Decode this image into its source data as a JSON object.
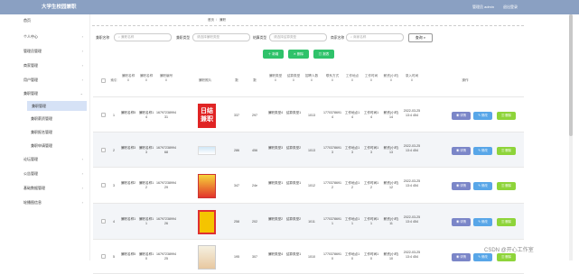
{
  "topbar": {
    "title": "大学生校园兼职",
    "user": "管理员 admin",
    "logout": "退出登录"
  },
  "sidebar": {
    "items": [
      {
        "label": "首页"
      },
      {
        "label": "个人中心"
      },
      {
        "label": "管理员管理"
      },
      {
        "label": "商家管理"
      },
      {
        "label": "用户管理"
      },
      {
        "label": "兼职管理"
      }
    ],
    "active": {
      "label": "兼职管理"
    },
    "subs": [
      {
        "label": "兼职薪资管理"
      },
      {
        "label": "兼职报名管理"
      },
      {
        "label": "兼职申请管理"
      }
    ],
    "more": [
      {
        "label": "论坛管理"
      },
      {
        "label": "公告管理"
      },
      {
        "label": "基础数据管理"
      },
      {
        "label": "轮播图信息"
      }
    ]
  },
  "breadcrumb": {
    "home": "首页",
    "current": "兼职"
  },
  "search": {
    "fields": [
      {
        "label": "兼职名称",
        "placeholder": "兼职名称"
      },
      {
        "label": "兼职类型",
        "placeholder": "请选择兼职类型"
      },
      {
        "label": "结算类型",
        "placeholder": "请选择结算类型"
      },
      {
        "label": "商家名称",
        "placeholder": "商家名称"
      }
    ],
    "button": "查询"
  },
  "actions": {
    "add": "新增",
    "delete": "删除",
    "report": "报表"
  },
  "table": {
    "headers": [
      "索引",
      "兼职名称",
      "兼职名称",
      "兼职编号",
      "兼职照片",
      "数",
      "数",
      "兼职类型",
      "结算类型",
      "招聘人数",
      "联系方式",
      "工作地点",
      "工作时间",
      "薪资(小时)",
      "录入时间",
      "操作"
    ],
    "rows": [
      {
        "idx": "1",
        "name": "兼职名称5",
        "name2": "兼职名称14",
        "code": "1679723899431",
        "v1": "337",
        "v2": "297",
        "type": "兼职类型4",
        "settle": "结算类型1",
        "count": "1013",
        "phone": "17703786914",
        "place": "工作地点14",
        "time": "工作时间14",
        "salary": "薪资(小时)14",
        "date": "2022-03-25 13:4 454",
        "img": "red"
      },
      {
        "idx": "2",
        "name": "兼职名称3",
        "name2": "兼职名称13",
        "code": "1679723899468",
        "v1": "286",
        "v2": "456",
        "type": "兼职类型3",
        "settle": "结算类型2",
        "count": "1013",
        "phone": "17703786913",
        "place": "工作地点13",
        "time": "工作时间13",
        "salary": "薪资(小时)13",
        "date": "2022-03-25 13:4 454",
        "img": "light"
      },
      {
        "idx": "3",
        "name": "兼职名称2",
        "name2": "兼职名称12",
        "code": "1679723899429",
        "v1": "347",
        "v2": "24e",
        "type": "兼职类型1",
        "settle": "结算类型1",
        "count": "1012",
        "phone": "17703786912",
        "place": "工作地点12",
        "time": "工作时间12",
        "salary": "薪资(小时)12",
        "date": "2022-03-25 13:4 454",
        "img": "yellow"
      },
      {
        "idx": "4",
        "name": "兼职名称1",
        "name2": "兼职名称11",
        "code": "1679723899426",
        "v1": "258",
        "v2": "202",
        "type": "兼职类型2",
        "settle": "结算类型2",
        "count": "1011",
        "phone": "17703786911",
        "place": "工作地点11",
        "time": "工作时间11",
        "salary": "薪资(小时)11",
        "date": "2022-03-25 13:4 454",
        "img": "orange"
      },
      {
        "idx": "5",
        "name": "兼职名称5",
        "name2": "兼职名称10",
        "code": "1679723899425",
        "v1": "195",
        "v2": "307",
        "type": "兼职类型4",
        "settle": "结算类型1",
        "count": "1010",
        "phone": "17703786910",
        "place": "工作地点10",
        "time": "工作时间10",
        "salary": "薪资(小时)10",
        "date": "2022-03-25 13:4 454",
        "img": "cartoon"
      }
    ],
    "ops": {
      "detail": "详情",
      "edit": "修改",
      "del": "删除"
    },
    "thumb1_text": "日结\n兼职"
  },
  "watermark": "CSDN @开心工作室"
}
